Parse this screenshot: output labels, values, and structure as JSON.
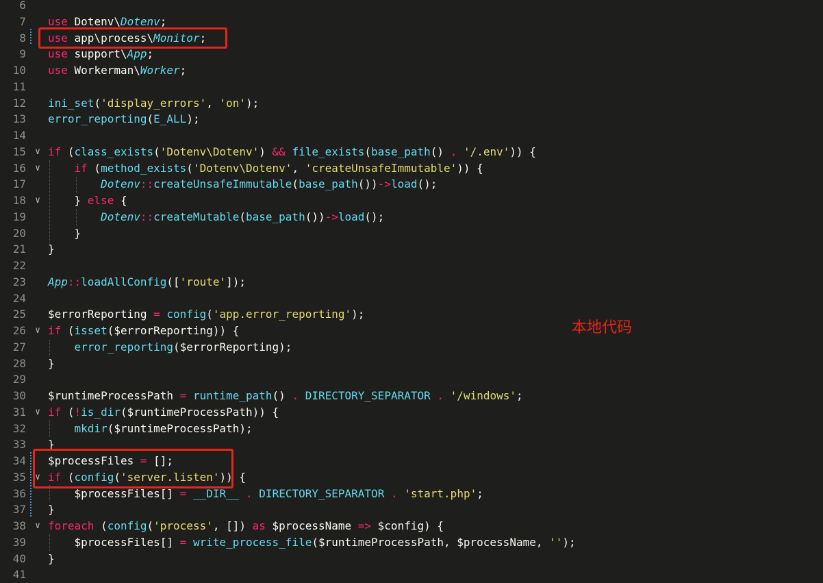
{
  "lines": [
    {
      "n": "6",
      "fold": "",
      "tokens": []
    },
    {
      "n": "7",
      "fold": "",
      "tokens": [
        [
          "k",
          "use"
        ],
        [
          "v",
          " Dotenv\\"
        ],
        [
          "c",
          "Dotenv"
        ],
        [
          "v",
          ";"
        ]
      ]
    },
    {
      "n": "8",
      "fold": "",
      "tokens": [
        [
          "k",
          "use"
        ],
        [
          "v",
          " app\\process\\"
        ],
        [
          "c",
          "Monitor"
        ],
        [
          "v",
          ";"
        ]
      ]
    },
    {
      "n": "9",
      "fold": "",
      "tokens": [
        [
          "k",
          "use"
        ],
        [
          "v",
          " support\\"
        ],
        [
          "c",
          "App"
        ],
        [
          "v",
          ";"
        ]
      ]
    },
    {
      "n": "10",
      "fold": "",
      "tokens": [
        [
          "k",
          "use"
        ],
        [
          "v",
          " Workerman\\"
        ],
        [
          "c",
          "Worker"
        ],
        [
          "v",
          ";"
        ]
      ]
    },
    {
      "n": "11",
      "fold": "",
      "tokens": []
    },
    {
      "n": "12",
      "fold": "",
      "tokens": [
        [
          "f",
          "ini_set"
        ],
        [
          "v",
          "("
        ],
        [
          "s",
          "'display_errors'"
        ],
        [
          "v",
          ", "
        ],
        [
          "s",
          "'on'"
        ],
        [
          "v",
          ");"
        ]
      ]
    },
    {
      "n": "13",
      "fold": "",
      "tokens": [
        [
          "f",
          "error_reporting"
        ],
        [
          "v",
          "("
        ],
        [
          "f",
          "E_ALL"
        ],
        [
          "v",
          ");"
        ]
      ]
    },
    {
      "n": "14",
      "fold": "",
      "tokens": []
    },
    {
      "n": "15",
      "fold": "∨",
      "tokens": [
        [
          "k",
          "if"
        ],
        [
          "v",
          " ("
        ],
        [
          "f",
          "class_exists"
        ],
        [
          "v",
          "("
        ],
        [
          "s",
          "'Dotenv\\Dotenv'"
        ],
        [
          "v",
          ") "
        ],
        [
          "o",
          "&&"
        ],
        [
          "v",
          " "
        ],
        [
          "f",
          "file_exists"
        ],
        [
          "v",
          "("
        ],
        [
          "f",
          "base_path"
        ],
        [
          "v",
          "() "
        ],
        [
          "o",
          "."
        ],
        [
          "v",
          " "
        ],
        [
          "s",
          "'/.env'"
        ],
        [
          "v",
          ")) {"
        ]
      ]
    },
    {
      "n": "16",
      "fold": "∨",
      "tokens": [
        [
          "v",
          "    "
        ],
        [
          "k",
          "if"
        ],
        [
          "v",
          " ("
        ],
        [
          "f",
          "method_exists"
        ],
        [
          "v",
          "("
        ],
        [
          "s",
          "'Dotenv\\Dotenv'"
        ],
        [
          "v",
          ", "
        ],
        [
          "s",
          "'createUnsafeImmutable'"
        ],
        [
          "v",
          ")) {"
        ]
      ]
    },
    {
      "n": "17",
      "fold": "",
      "tokens": [
        [
          "v",
          "        "
        ],
        [
          "c",
          "Dotenv"
        ],
        [
          "o",
          "::"
        ],
        [
          "f",
          "createUnsafeImmutable"
        ],
        [
          "v",
          "("
        ],
        [
          "f",
          "base_path"
        ],
        [
          "v",
          "())"
        ],
        [
          "o",
          "->"
        ],
        [
          "f",
          "load"
        ],
        [
          "v",
          "();"
        ]
      ]
    },
    {
      "n": "18",
      "fold": "∨",
      "tokens": [
        [
          "v",
          "    } "
        ],
        [
          "k",
          "else"
        ],
        [
          "v",
          " {"
        ]
      ]
    },
    {
      "n": "19",
      "fold": "",
      "tokens": [
        [
          "v",
          "        "
        ],
        [
          "c",
          "Dotenv"
        ],
        [
          "o",
          "::"
        ],
        [
          "f",
          "createMutable"
        ],
        [
          "v",
          "("
        ],
        [
          "f",
          "base_path"
        ],
        [
          "v",
          "())"
        ],
        [
          "o",
          "->"
        ],
        [
          "f",
          "load"
        ],
        [
          "v",
          "();"
        ]
      ]
    },
    {
      "n": "20",
      "fold": "",
      "tokens": [
        [
          "v",
          "    }"
        ]
      ]
    },
    {
      "n": "21",
      "fold": "",
      "tokens": [
        [
          "v",
          "}"
        ]
      ]
    },
    {
      "n": "22",
      "fold": "",
      "tokens": []
    },
    {
      "n": "23",
      "fold": "",
      "tokens": [
        [
          "c",
          "App"
        ],
        [
          "o",
          "::"
        ],
        [
          "f",
          "loadAllConfig"
        ],
        [
          "v",
          "(["
        ],
        [
          "s",
          "'route'"
        ],
        [
          "v",
          "]);"
        ]
      ]
    },
    {
      "n": "24",
      "fold": "",
      "tokens": []
    },
    {
      "n": "25",
      "fold": "",
      "tokens": [
        [
          "v",
          "$errorReporting "
        ],
        [
          "o",
          "="
        ],
        [
          "v",
          " "
        ],
        [
          "f",
          "config"
        ],
        [
          "v",
          "("
        ],
        [
          "s",
          "'app.error_reporting'"
        ],
        [
          "v",
          ");"
        ]
      ]
    },
    {
      "n": "26",
      "fold": "∨",
      "tokens": [
        [
          "k",
          "if"
        ],
        [
          "v",
          " ("
        ],
        [
          "f",
          "isset"
        ],
        [
          "v",
          "($errorReporting)) {"
        ]
      ]
    },
    {
      "n": "27",
      "fold": "",
      "tokens": [
        [
          "v",
          "    "
        ],
        [
          "f",
          "error_reporting"
        ],
        [
          "v",
          "($errorReporting);"
        ]
      ]
    },
    {
      "n": "28",
      "fold": "",
      "tokens": [
        [
          "v",
          "}"
        ]
      ]
    },
    {
      "n": "29",
      "fold": "",
      "tokens": []
    },
    {
      "n": "30",
      "fold": "",
      "tokens": [
        [
          "v",
          "$runtimeProcessPath "
        ],
        [
          "o",
          "="
        ],
        [
          "v",
          " "
        ],
        [
          "f",
          "runtime_path"
        ],
        [
          "v",
          "() "
        ],
        [
          "o",
          "."
        ],
        [
          "v",
          " "
        ],
        [
          "f",
          "DIRECTORY_SEPARATOR"
        ],
        [
          "v",
          " "
        ],
        [
          "o",
          "."
        ],
        [
          "v",
          " "
        ],
        [
          "s",
          "'/windows'"
        ],
        [
          "v",
          ";"
        ]
      ]
    },
    {
      "n": "31",
      "fold": "∨",
      "tokens": [
        [
          "k",
          "if"
        ],
        [
          "v",
          " ("
        ],
        [
          "o",
          "!"
        ],
        [
          "f",
          "is_dir"
        ],
        [
          "v",
          "($runtimeProcessPath)) {"
        ]
      ]
    },
    {
      "n": "32",
      "fold": "",
      "tokens": [
        [
          "v",
          "    "
        ],
        [
          "f",
          "mkdir"
        ],
        [
          "v",
          "($runtimeProcessPath);"
        ]
      ]
    },
    {
      "n": "33",
      "fold": "",
      "tokens": [
        [
          "v",
          "}"
        ]
      ]
    },
    {
      "n": "34",
      "fold": "",
      "tokens": [
        [
          "v",
          "$processFiles "
        ],
        [
          "o",
          "="
        ],
        [
          "v",
          " [];"
        ]
      ]
    },
    {
      "n": "35",
      "fold": "∨",
      "tokens": [
        [
          "k",
          "if"
        ],
        [
          "v",
          " ("
        ],
        [
          "f",
          "config"
        ],
        [
          "v",
          "("
        ],
        [
          "s",
          "'server.listen'"
        ],
        [
          "v",
          ")) {"
        ]
      ]
    },
    {
      "n": "36",
      "fold": "",
      "tokens": [
        [
          "v",
          "    $processFiles[] "
        ],
        [
          "o",
          "="
        ],
        [
          "v",
          " "
        ],
        [
          "f",
          "__DIR__"
        ],
        [
          "v",
          " "
        ],
        [
          "o",
          "."
        ],
        [
          "v",
          " "
        ],
        [
          "f",
          "DIRECTORY_SEPARATOR"
        ],
        [
          "v",
          " "
        ],
        [
          "o",
          "."
        ],
        [
          "v",
          " "
        ],
        [
          "s",
          "'start.php'"
        ],
        [
          "v",
          ";"
        ]
      ]
    },
    {
      "n": "37",
      "fold": "",
      "tokens": [
        [
          "v",
          "}"
        ]
      ]
    },
    {
      "n": "38",
      "fold": "∨",
      "tokens": [
        [
          "k",
          "foreach"
        ],
        [
          "v",
          " ("
        ],
        [
          "f",
          "config"
        ],
        [
          "v",
          "("
        ],
        [
          "s",
          "'process'"
        ],
        [
          "v",
          ", []) "
        ],
        [
          "k",
          "as"
        ],
        [
          "v",
          " $processName "
        ],
        [
          "o",
          "=>"
        ],
        [
          "v",
          " $config) {"
        ]
      ]
    },
    {
      "n": "39",
      "fold": "",
      "tokens": [
        [
          "v",
          "    $processFiles[] "
        ],
        [
          "o",
          "="
        ],
        [
          "v",
          " "
        ],
        [
          "f",
          "write_process_file"
        ],
        [
          "v",
          "($runtimeProcessPath, $processName, "
        ],
        [
          "s",
          "''"
        ],
        [
          "v",
          ");"
        ]
      ]
    },
    {
      "n": "40",
      "fold": "",
      "tokens": [
        [
          "v",
          "}"
        ]
      ]
    },
    {
      "n": "41",
      "fold": "",
      "tokens": []
    }
  ],
  "annotation": "本地代码",
  "colors": {
    "highlight_box": "#e8251b",
    "background": "#1e1f1c"
  }
}
